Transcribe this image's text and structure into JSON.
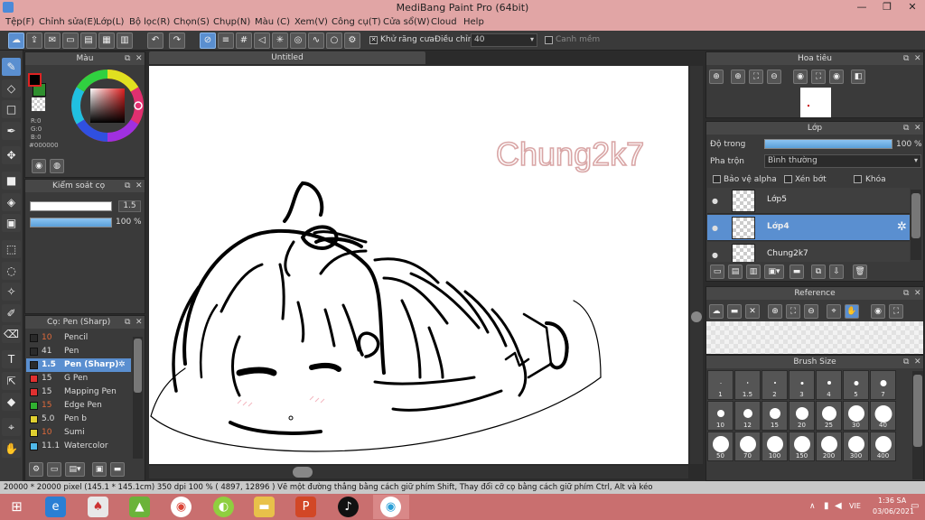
{
  "window": {
    "title": "MediBang Paint Pro (64bit)",
    "minimize": "—",
    "restore": "❐",
    "close": "✕"
  },
  "menu": [
    "Tệp(F)",
    "Chỉnh sửa(E)",
    "Lớp(L)",
    "Bộ lọc(R)",
    "Chọn(S)",
    "Chụp(N)",
    "Màu (C)",
    "Xem(V)",
    "Công cụ(T)",
    "Cửa sổ(W)",
    "Cloud",
    "Help"
  ],
  "toolbar": {
    "antialias_label": "Khử răng cưa",
    "adjust_label": "Điều chỉnh",
    "adjust_value": "40",
    "snap_label": "Canh mềm"
  },
  "color_panel": {
    "title": "Màu",
    "r": "R:0",
    "g": "G:0",
    "b": "B:0",
    "hex": "#000000",
    "primary": "#000000",
    "secondary": "#ffffff"
  },
  "brush_control": {
    "title": "Kiểm soát cọ",
    "size": "1.5",
    "opacity": "100 %"
  },
  "brush_panel": {
    "title": "Cọ: Pen (Sharp)",
    "items": [
      {
        "size": "10",
        "name": "Pencil",
        "color": "#2a2a2a",
        "size_color": "#e06a3a"
      },
      {
        "size": "41",
        "name": "Pen",
        "color": "#2a2a2a",
        "size_color": "#dddddd"
      },
      {
        "size": "1.5",
        "name": "Pen (Sharp)",
        "color": "#2a2a2a",
        "size_color": "#ffffff"
      },
      {
        "size": "15",
        "name": "G Pen",
        "color": "#e03030",
        "size_color": "#dddddd"
      },
      {
        "size": "15",
        "name": "Mapping Pen",
        "color": "#e03030",
        "size_color": "#dddddd"
      },
      {
        "size": "15",
        "name": "Edge Pen",
        "color": "#30b030",
        "size_color": "#e06a3a"
      },
      {
        "size": "5.0",
        "name": "Pen b",
        "color": "#e0d030",
        "size_color": "#dddddd"
      },
      {
        "size": "10",
        "name": "Sumi",
        "color": "#e0d030",
        "size_color": "#e06a3a"
      },
      {
        "size": "11.1",
        "name": "Watercolor",
        "color": "#50b8e8",
        "size_color": "#dddddd"
      }
    ]
  },
  "document": {
    "tab_title": "Untitled",
    "watermark": "Chung2k7"
  },
  "navigator": {
    "title": "Hoa tiêu"
  },
  "layer_panel": {
    "title": "Lớp",
    "opacity_label": "Độ trong",
    "opacity_value": "100 %",
    "blend_label": "Pha trộn",
    "blend_value": "Bình thường",
    "protect_alpha": "Bảo vệ alpha",
    "clipping": "Xén bớt",
    "lock": "Khóa",
    "layers": [
      {
        "name": "Lớp5",
        "selected": false
      },
      {
        "name": "Lớp4",
        "selected": true
      },
      {
        "name": "Chung2k7",
        "selected": false
      }
    ]
  },
  "reference": {
    "title": "Reference"
  },
  "brush_size": {
    "title": "Brush Size",
    "sizes": [
      "1",
      "1.5",
      "2",
      "3",
      "4",
      "5",
      "7",
      "10",
      "12",
      "15",
      "20",
      "25",
      "30",
      "40",
      "50",
      "70",
      "100",
      "150",
      "200",
      "300",
      "400"
    ]
  },
  "status": {
    "text": "20000 * 20000 pixel   (145.1 * 145.1cm)   350 dpi   100 %   ( 4897, 12896 )   Vẽ một đường thẳng bằng cách giữ phím Shift, Thay đổi cỡ cọ bằng cách giữ phím Ctrl, Alt và kéo"
  },
  "taskbar": {
    "lang": "VIE",
    "time": "1:36 SA",
    "date": "03/06/2021"
  }
}
